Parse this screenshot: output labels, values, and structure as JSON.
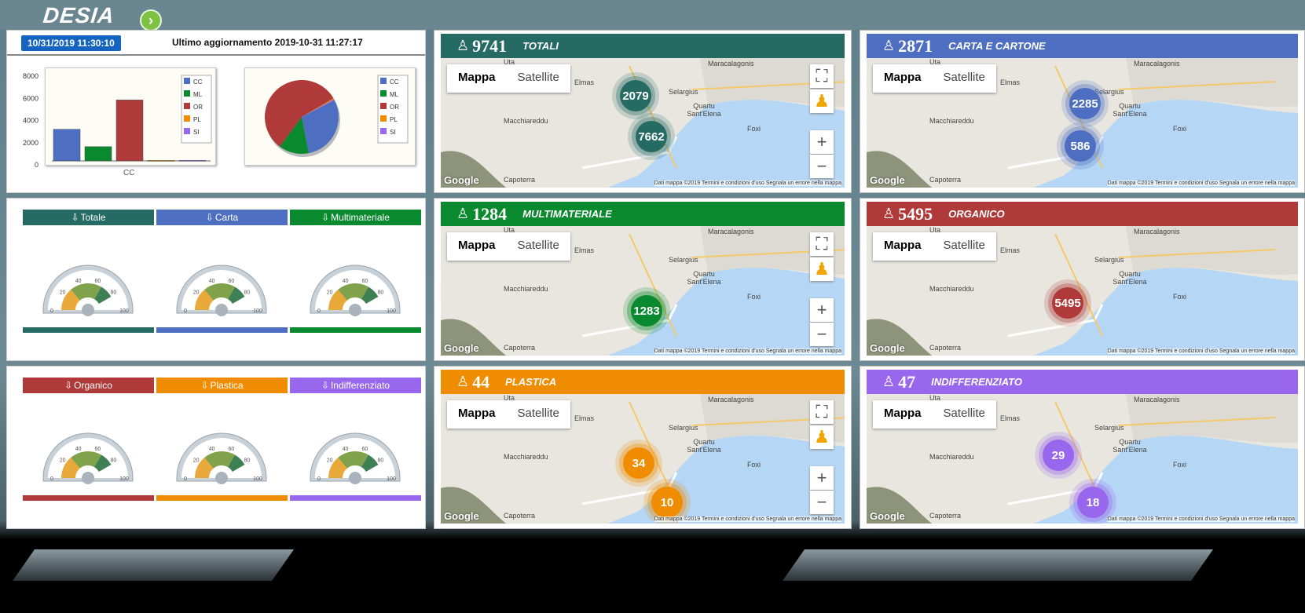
{
  "app": {
    "logo": "DESIA",
    "go_icon": "chevron-right-icon"
  },
  "status": {
    "datetime": "10/31/2019 11:30:10",
    "last_update": "Ultimo aggiornamento 2019-10-31 11:27:17"
  },
  "chart_data": [
    {
      "type": "bar",
      "categories": [
        "CC"
      ],
      "series": [
        {
          "name": "CC",
          "values": [
            2850
          ]
        },
        {
          "name": "ML",
          "values": [
            1284
          ]
        },
        {
          "name": "OR",
          "values": [
            5495
          ]
        },
        {
          "name": "PL",
          "values": [
            44
          ]
        },
        {
          "name": "SI",
          "values": [
            47
          ]
        }
      ],
      "xlabel": "CC",
      "ylim": [
        0,
        8000
      ],
      "yticks": [
        "8000",
        "6000",
        "4000",
        "2000",
        "0"
      ],
      "legend": "top-right",
      "colors": {
        "CC": "#4e6fc1",
        "ML": "#0a8a2e",
        "OR": "#b03a3a",
        "PL": "#f08c00",
        "SI": "#9966ee"
      }
    },
    {
      "type": "pie",
      "series": [
        {
          "name": "CC",
          "value": 2871
        },
        {
          "name": "ML",
          "value": 1284
        },
        {
          "name": "OR",
          "value": 5495
        },
        {
          "name": "PL",
          "value": 44
        },
        {
          "name": "SI",
          "value": 47
        }
      ],
      "legend": "right"
    }
  ],
  "gauges": [
    {
      "label": "Totale",
      "color": "#266b63",
      "ticks": [
        "0",
        "20",
        "40",
        "60",
        "80",
        "100"
      ]
    },
    {
      "label": "Carta",
      "color": "#4e6fc1",
      "ticks": [
        "0",
        "20",
        "40",
        "60",
        "80",
        "100"
      ]
    },
    {
      "label": "Multimateriale",
      "color": "#0a8a2e",
      "ticks": [
        "0",
        "20",
        "40",
        "60",
        "80",
        "100"
      ]
    },
    {
      "label": "Organico",
      "color": "#b03a3a",
      "ticks": [
        "0",
        "20",
        "40",
        "60",
        "80",
        "100"
      ]
    },
    {
      "label": "Plastica",
      "color": "#f08c00",
      "ticks": [
        "0",
        "20",
        "40",
        "60",
        "80",
        "100"
      ]
    },
    {
      "label": "Indifferenziato",
      "color": "#9966ee",
      "ticks": [
        "0",
        "20",
        "40",
        "60",
        "80",
        "100"
      ]
    }
  ],
  "map_common": {
    "mappa": "Mappa",
    "satellite": "Satellite",
    "google": "Google",
    "footer": "Dati mappa ©2019  Termini e condizioni d'uso  Segnala un errore nella mappa",
    "places": [
      "Maracalagonis",
      "Selargius",
      "Quartu Sant'Elena",
      "Macchiareddu",
      "Elmas",
      "Capoterra",
      "Foxi",
      "Uta"
    ]
  },
  "maps": [
    {
      "count": "9741",
      "title": "TOTALI",
      "color": "#266b63",
      "clusters": [
        "2079",
        "7662"
      ]
    },
    {
      "count": "2871",
      "title": "CARTA E CARTONE",
      "color": "#4e6fc1",
      "clusters": [
        "2285",
        "586"
      ]
    },
    {
      "count": "1284",
      "title": "MULTIMATERIALE",
      "color": "#0a8a2e",
      "clusters": [
        "1283"
      ]
    },
    {
      "count": "5495",
      "title": "ORGANICO",
      "color": "#b03a3a",
      "clusters": [
        "5495"
      ]
    },
    {
      "count": "44",
      "title": "PLASTICA",
      "color": "#f08c00",
      "clusters": [
        "34",
        "10"
      ]
    },
    {
      "count": "47",
      "title": "INDIFFERENZIATO",
      "color": "#9966ee",
      "clusters": [
        "29",
        "18"
      ]
    }
  ]
}
